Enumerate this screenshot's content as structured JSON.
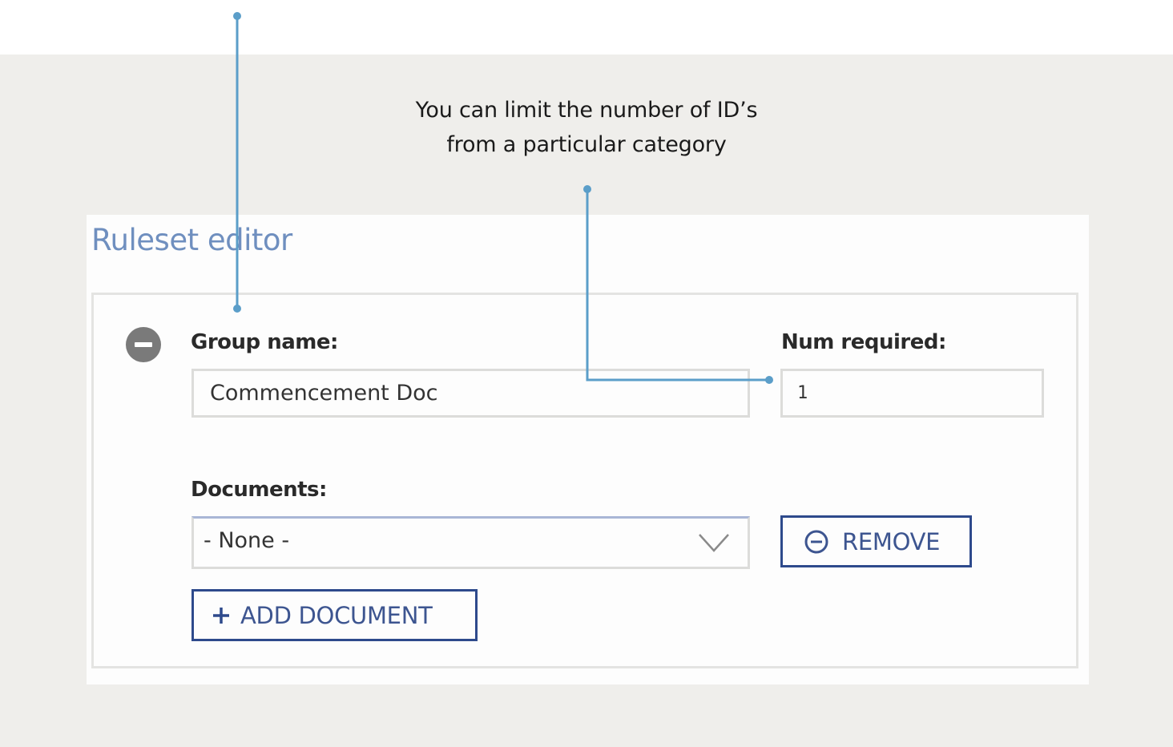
{
  "callout": {
    "line1": "You can limit the number of ID’s",
    "line2": "from a particular category"
  },
  "editor": {
    "title": "Ruleset editor",
    "group": {
      "name_label": "Group name:",
      "name_value": "Commencement Doc",
      "num_label": "Num required:",
      "num_value": "1",
      "documents_label": "Documents:",
      "documents_selected": "- None -",
      "remove_label": "REMOVE",
      "add_label": "ADD DOCUMENT"
    }
  },
  "colors": {
    "annotation_line": "#5b9ec9",
    "title": "#6f8fbf",
    "button_border": "#2e4a8c",
    "remove_group_icon": "#7a7a7a",
    "backdrop": "#efeeeb"
  },
  "icons": {
    "remove_group": "minus-circle-icon",
    "remove_button": "minus-circle-outline-icon",
    "add_button": "plus-icon",
    "select": "chevron-down-icon"
  }
}
